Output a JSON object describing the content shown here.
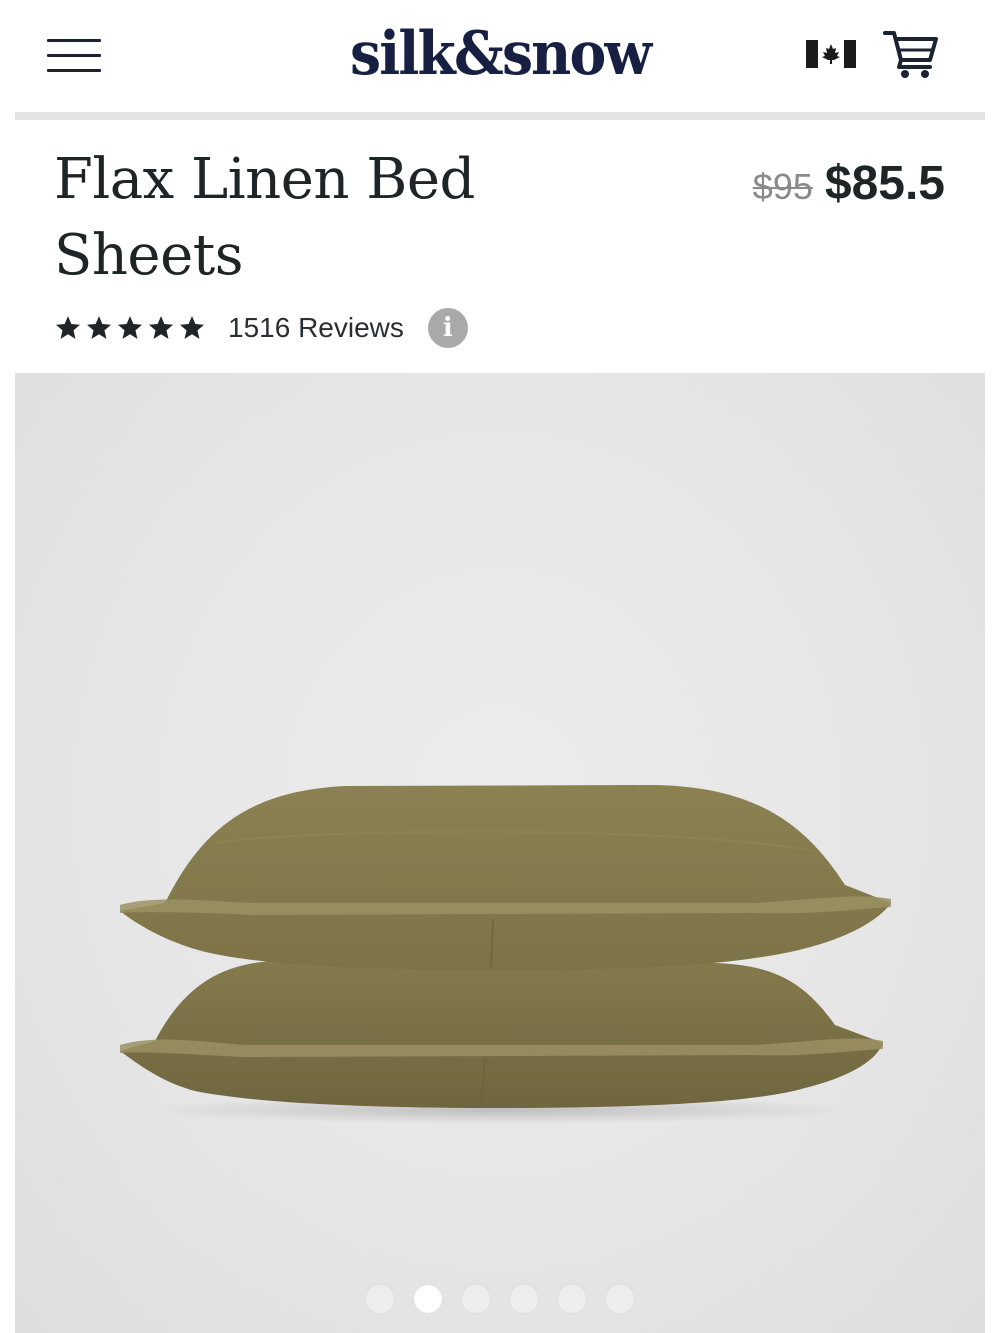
{
  "header": {
    "logo_text": "silk&snow",
    "menu_icon": "hamburger-menu-icon",
    "flag_icon": "canada-flag-icon",
    "cart_icon": "shopping-cart-icon"
  },
  "product": {
    "title": "Flax Linen Bed Sheets",
    "price_original": "$95",
    "price_sale": "$85.5",
    "rating_stars": 5,
    "reviews_text": "1516 Reviews",
    "info_glyph": "i"
  },
  "gallery": {
    "image_alt": "Two stacked olive green linen pillowcases",
    "pillow_color": "#857a4e",
    "dot_count": 6,
    "active_dot_index": 1
  },
  "colors": {
    "brand_navy": "#172042",
    "text_dark": "#1f2527",
    "muted_gray": "#8a8a8a",
    "image_bg": "#e6e6e6"
  }
}
